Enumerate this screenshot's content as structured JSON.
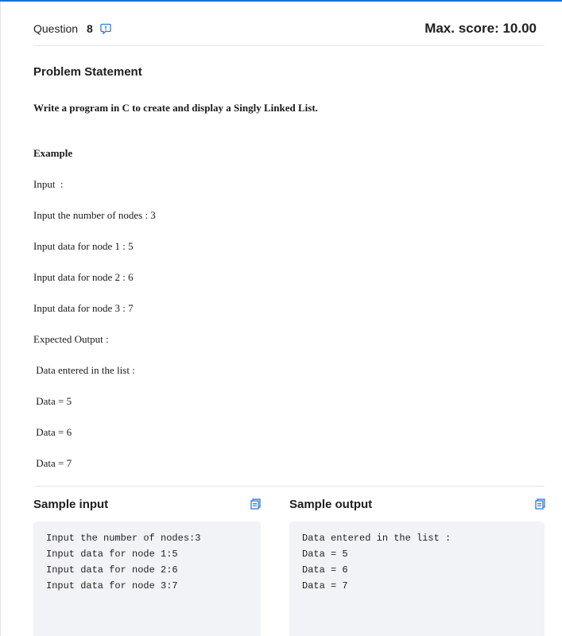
{
  "header": {
    "question_label": "Question",
    "question_number": "8",
    "max_score": "Max. score: 10.00"
  },
  "problem": {
    "title": "Problem Statement",
    "lines": [
      "Write a program in C to create and display a Singly Linked List.",
      "Example",
      "Input  :",
      "Input the number of nodes : 3",
      "Input data for node 1 : 5",
      "Input data for node 2 : 6",
      "Input data for node 3 : 7",
      "Expected Output :",
      " Data entered in the list :",
      " Data = 5",
      " Data = 6",
      " Data = 7"
    ]
  },
  "sample_input": {
    "title": "Sample input",
    "lines": [
      "Input the number of nodes:3",
      "Input data for node 1:5",
      "Input data for node 2:6",
      "Input data for node 3:7"
    ]
  },
  "sample_output": {
    "title": "Sample output",
    "lines": [
      "Data entered in the list :",
      "Data = 5",
      "Data = 6",
      "Data = 7"
    ]
  },
  "colors": {
    "accent": "#1f6fd1",
    "icon_blue": "#2f7ad6",
    "code_bg": "#f2f3f6",
    "divider": "#e4e6ea"
  },
  "icons": {
    "flag": "report-issue-icon",
    "copy": "copy-icon"
  }
}
